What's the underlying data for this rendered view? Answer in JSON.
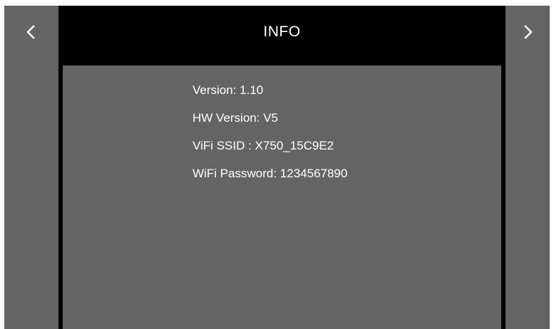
{
  "header": {
    "title": "INFO"
  },
  "navigation": {
    "prev_icon": "chevron-left-icon",
    "next_icon": "chevron-right-icon"
  },
  "info": {
    "lines": [
      "Version: 1.10",
      "HW Version: V5",
      "ViFi SSID : X750_15C9E2",
      "WiFi Password: 1234567890"
    ]
  },
  "colors": {
    "panel": "#646464",
    "background": "#000000",
    "text": "#ffffff"
  }
}
